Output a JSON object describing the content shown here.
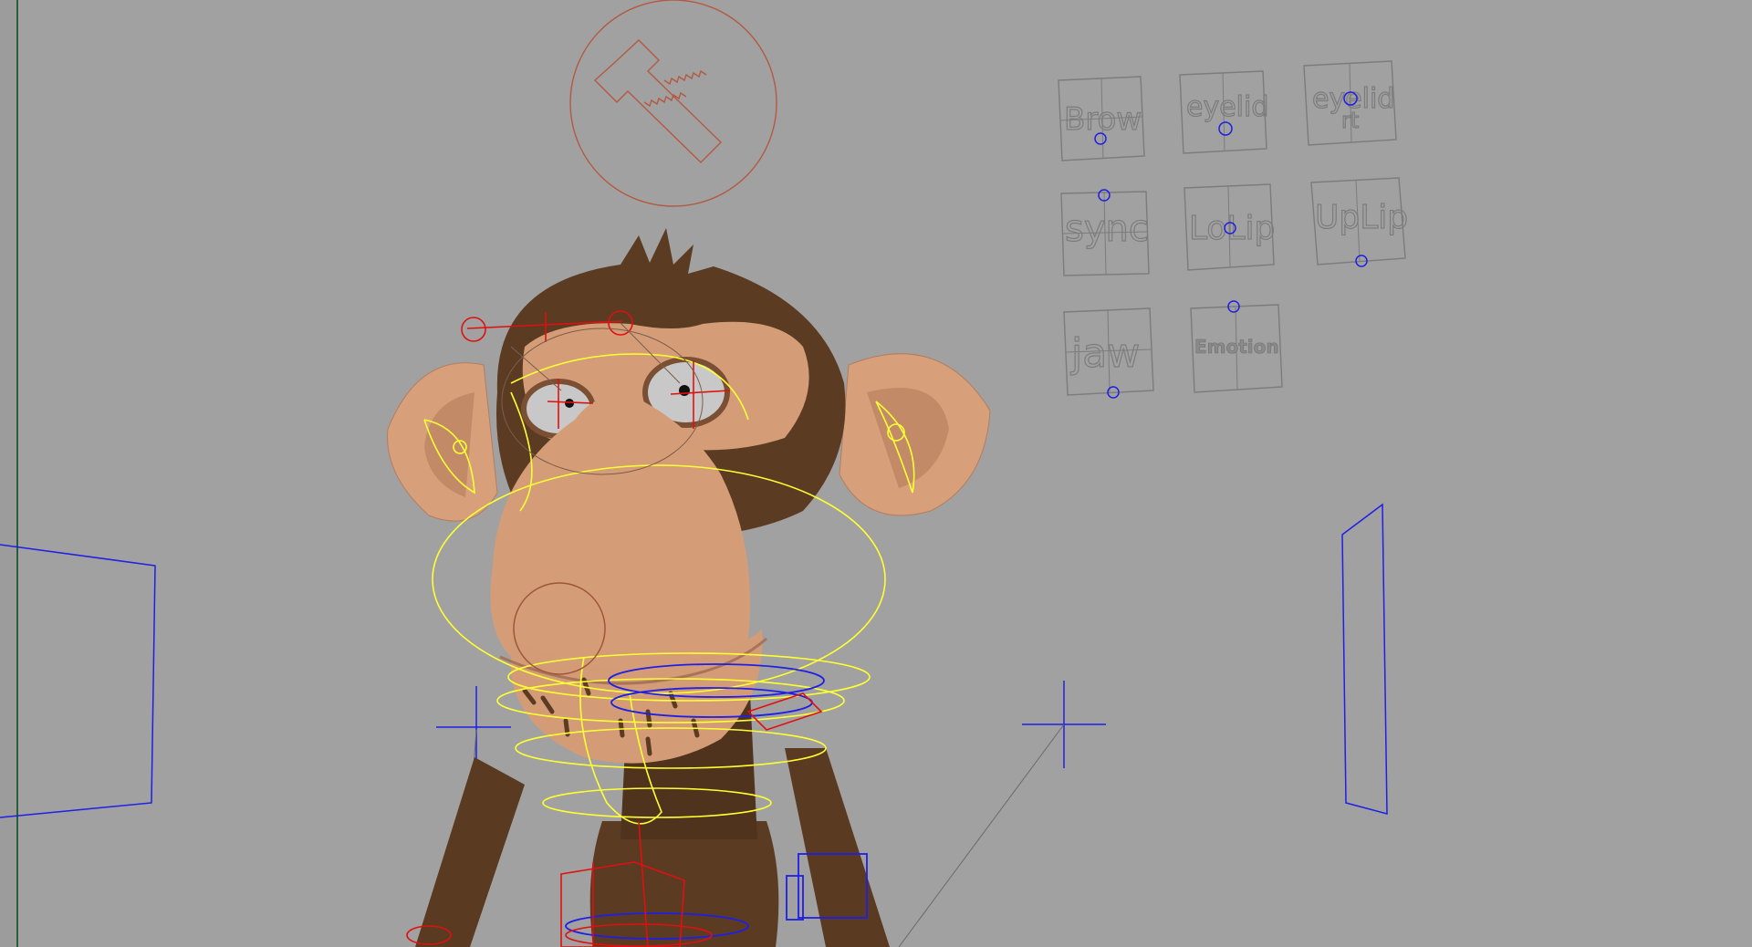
{
  "viewport": {
    "background": "#a1a1a1",
    "left_edge_color": "#2d5a38"
  },
  "face_controls": [
    {
      "label": "Brow"
    },
    {
      "label": "eyelid"
    },
    {
      "label": "eyelid rt"
    },
    {
      "label": "sync"
    },
    {
      "label": "LoLip"
    },
    {
      "label": "UpLip"
    },
    {
      "label": "jaw"
    },
    {
      "label": "Emotion"
    }
  ],
  "colors": {
    "fur": "#5b3b22",
    "skin": "#d6a07c",
    "nurbs_yellow": "#ffff33",
    "nurbs_blue": "#1f1fe6",
    "nurbs_red": "#e01010",
    "gui_grey": "#7c7c7c",
    "head_control": "#b35a42"
  },
  "icons": {
    "head_control": "screw-circle-icon",
    "locator": "locator-cross-icon"
  }
}
